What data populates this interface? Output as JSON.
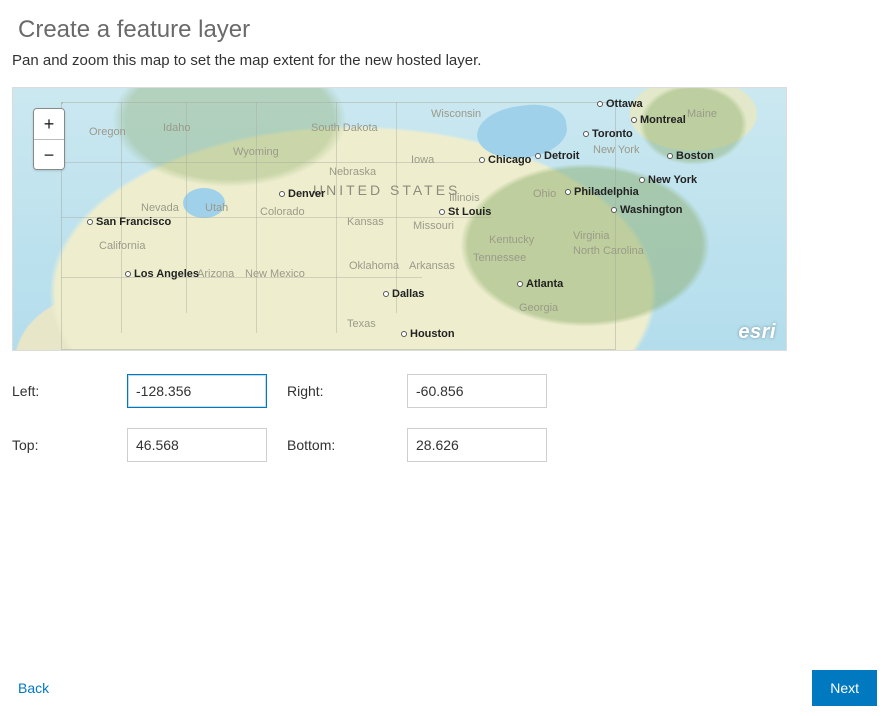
{
  "header": {
    "title": "Create a feature layer",
    "instructions": "Pan and zoom this map to set the map extent for the new hosted layer."
  },
  "map": {
    "zoom_in_label": "+",
    "zoom_out_label": "−",
    "attribution": "esri",
    "labels": {
      "country_big": "UNITED\nSTATES",
      "oregon": "Oregon",
      "idaho": "Idaho",
      "wyoming": "Wyoming",
      "south_dakota": "South Dakota",
      "wisconsin": "Wisconsin",
      "nevada": "Nevada",
      "utah": "Utah",
      "colorado": "Colorado",
      "nebraska": "Nebraska",
      "iowa": "Iowa",
      "kansas": "Kansas",
      "illinois": "Illinois",
      "missouri": "Missouri",
      "ohio": "Ohio",
      "kentucky": "Kentucky",
      "tennessee": "Tennessee",
      "oklahoma": "Oklahoma",
      "arkansas": "Arkansas",
      "texas": "Texas",
      "georgia": "Georgia",
      "north_carolina": "North\nCarolina",
      "virginia": "Virginia",
      "new_york_state": "New York",
      "arizona": "Arizona",
      "new_mexico": "New Mexico",
      "california": "California",
      "maine": "Maine"
    },
    "cities": {
      "san_francisco": "San Francisco",
      "los_angeles": "Los Angeles",
      "denver": "Denver",
      "st_louis": "St Louis",
      "chicago": "Chicago",
      "detroit": "Detroit",
      "toronto": "Toronto",
      "ottawa": "Ottawa",
      "montreal": "Montreal",
      "boston": "Boston",
      "new_york": "New York",
      "philadelphia": "Philadelphia",
      "washington": "Washington",
      "atlanta": "Atlanta",
      "dallas": "Dallas",
      "houston": "Houston"
    }
  },
  "extent": {
    "left_label": "Left:",
    "right_label": "Right:",
    "top_label": "Top:",
    "bottom_label": "Bottom:",
    "left": "-128.356",
    "right": "-60.856",
    "top": "46.568",
    "bottom": "28.626"
  },
  "footer": {
    "back": "Back",
    "next": "Next"
  }
}
